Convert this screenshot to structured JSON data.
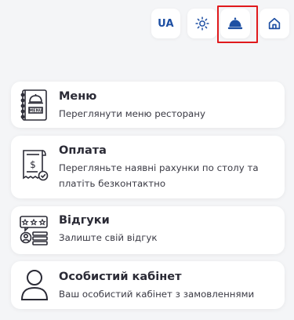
{
  "header": {
    "language_label": "UA",
    "buttons": {
      "theme_icon": "sun-icon",
      "waiter_icon": "service-bell-icon",
      "home_icon": "home-icon"
    },
    "accent_color": "#1d4fa3",
    "highlight_color": "#e0191c"
  },
  "cards": [
    {
      "title": "Меню",
      "description": "Переглянути меню ресторану",
      "icon": "menu-book-icon"
    },
    {
      "title": "Оплата",
      "description": "Перегляньте наявні рахунки по столу та платіть безконтактно",
      "icon": "receipt-icon"
    },
    {
      "title": "Відгуки",
      "description": "Залиште свій відгук",
      "icon": "review-icon"
    },
    {
      "title": "Особистий кабінет",
      "description": "Ваш особистий кабінет з замовленнями",
      "icon": "user-icon"
    }
  ]
}
